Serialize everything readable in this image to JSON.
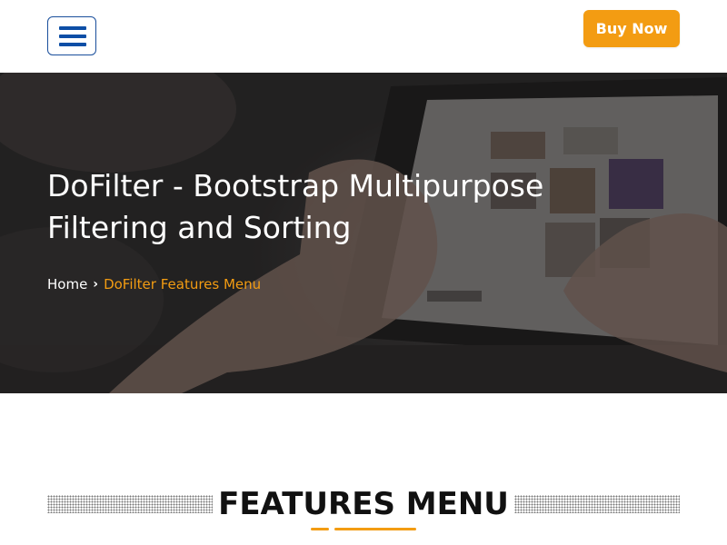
{
  "header": {
    "menu_icon": "hamburger-menu-icon",
    "buy_button_label": "Buy Now"
  },
  "hero": {
    "title_line1": "DoFilter - Bootstrap Multipurpose",
    "title_line2": "Filtering and Sorting",
    "breadcrumb": {
      "home": "Home",
      "separator_icon": "chevron-right-icon",
      "separator": "›",
      "current": "DoFilter Features Menu"
    }
  },
  "features": {
    "heading_light": "FEATURES ",
    "heading_bold": "MENU"
  },
  "colors": {
    "accent": "#f39c12",
    "brand_blue": "#0d4ea6",
    "hero_bg": "#2f2c2c"
  }
}
